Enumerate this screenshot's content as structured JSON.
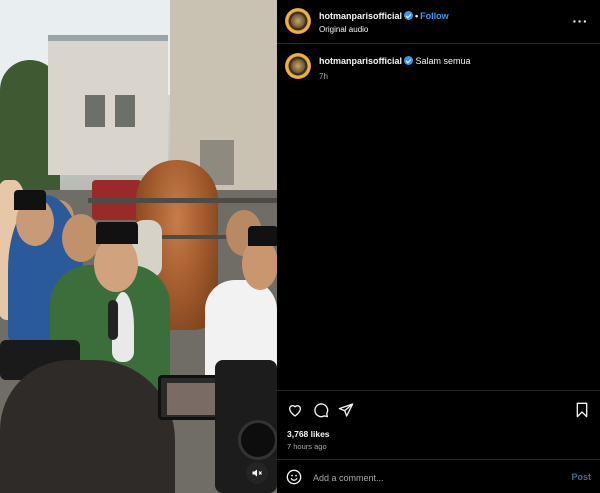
{
  "header": {
    "username": "hotmanparisofficial",
    "follow_label": "Follow",
    "separator": "•",
    "audio_label": "Original audio",
    "more_label": "···"
  },
  "caption": {
    "username": "hotmanparisofficial",
    "text": "Salam semua",
    "time": "7h"
  },
  "actions": {
    "likes": "3,768 likes",
    "posted_ago": "7 hours ago"
  },
  "comment_box": {
    "placeholder": "Add a comment...",
    "post_label": "Post"
  },
  "icons": {
    "verified": "verified-badge-icon",
    "like": "heart-icon",
    "comment": "comment-bubble-icon",
    "share": "paper-plane-icon",
    "save": "bookmark-icon",
    "emoji": "smiley-icon",
    "mute": "speaker-muted-icon",
    "more": "ellipsis-icon"
  },
  "colors": {
    "background": "#000000",
    "link_blue": "#3897f0",
    "secondary_text": "#a8a8a8",
    "post_disabled": "#4a6a8f"
  }
}
